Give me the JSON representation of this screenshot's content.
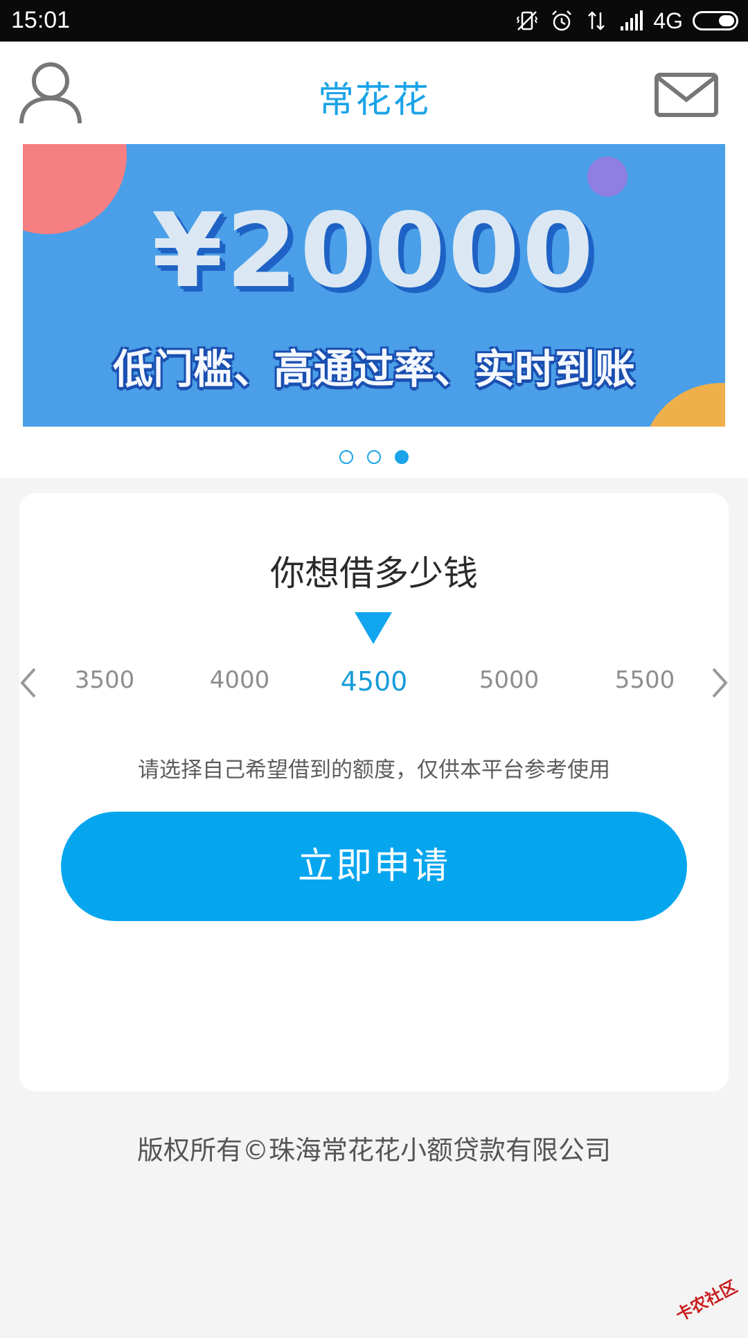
{
  "status_bar": {
    "time": "15:01",
    "network": "4G"
  },
  "header": {
    "title": "常花花"
  },
  "banner": {
    "amount": "¥20000",
    "tagline": "低门槛、高通过率、实时到账",
    "page_count": 3,
    "active_page": 3
  },
  "loan_card": {
    "question": "你想借多少钱",
    "amounts": [
      "3500",
      "4000",
      "4500",
      "5000",
      "5500"
    ],
    "selected_amount": "4500",
    "hint": "请选择自己希望借到的额度，仅供本平台参考使用",
    "apply_label": "立即申请"
  },
  "footer": {
    "copyright": "版权所有©珠海常花花小额贷款有限公司"
  },
  "watermark": {
    "text": "卡农社区"
  },
  "colors": {
    "accent": "#1aa3e8",
    "button": "#06a6ef",
    "banner_bg": "#4a9fe8",
    "page_bg": "#f4f4f4"
  }
}
